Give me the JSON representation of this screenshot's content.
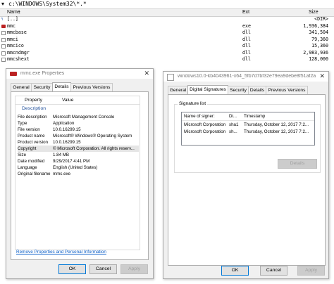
{
  "file_manager": {
    "path": "c:\\WINDOWS\\System32\\*.*",
    "columns": {
      "name": "Name",
      "ext": "Ext",
      "size": "Size",
      "sort_marker": "↓"
    },
    "rows": [
      {
        "name": "[..]",
        "ext": "",
        "size": "<DIR>",
        "icon": "up-folder-icon"
      },
      {
        "name": "mmc",
        "ext": "exe",
        "size": "1,936,384",
        "icon": "mmc-exe-icon"
      },
      {
        "name": "mmcbase",
        "ext": "dll",
        "size": "341,504",
        "icon": "dll-file-icon"
      },
      {
        "name": "mmci",
        "ext": "dll",
        "size": "79,360",
        "icon": "dll-file-icon"
      },
      {
        "name": "mmcico",
        "ext": "dll",
        "size": "15,360",
        "icon": "dll-file-icon"
      },
      {
        "name": "mmcndmgr",
        "ext": "dll",
        "size": "2,983,936",
        "icon": "dll-file-icon"
      },
      {
        "name": "mmcshext",
        "ext": "dll",
        "size": "128,000",
        "icon": "dll-file-icon"
      }
    ]
  },
  "properties_dialog": {
    "title": "mmc.exe Properties",
    "tabs": [
      "General",
      "Security",
      "Details",
      "Previous Versions"
    ],
    "active_tab": "Details",
    "grid_headers": {
      "property": "Property",
      "value": "Value"
    },
    "section": "Description",
    "rows": [
      {
        "k": "File description",
        "v": "Microsoft Management Console"
      },
      {
        "k": "Type",
        "v": "Application"
      },
      {
        "k": "File version",
        "v": "10.0.16299.15"
      },
      {
        "k": "Product name",
        "v": "Microsoft® Windows® Operating System"
      },
      {
        "k": "Product version",
        "v": "10.0.16299.15"
      },
      {
        "k": "Copyright",
        "v": "© Microsoft Corporation. All rights reserv..."
      },
      {
        "k": "Size",
        "v": "1.84 MB"
      },
      {
        "k": "Date modified",
        "v": "9/29/2017 4:41 PM"
      },
      {
        "k": "Language",
        "v": "English (United States)"
      },
      {
        "k": "Original filename",
        "v": "mmc.exe"
      }
    ],
    "link": "Remove Properties and Personal Information",
    "buttons": {
      "ok": "OK",
      "cancel": "Cancel",
      "apply": "Apply"
    }
  },
  "signature_dialog": {
    "title": "windows10.0-kb4043961-x64_5fb7d7bf32e79ea9debe8f51af2a0...",
    "tabs": [
      "General",
      "Digital Signatures",
      "Security",
      "Details",
      "Previous Versions"
    ],
    "active_tab": "Digital Signatures",
    "group_label": "Signature list",
    "list_headers": {
      "signer": "Name of signer:",
      "digest": "Di...",
      "timestamp": "Timestamp"
    },
    "rows": [
      {
        "signer": "Microsoft Corporation",
        "digest": "sha1",
        "timestamp": "Thursday, October 12, 2017 7:2..."
      },
      {
        "signer": "Microsoft Corporation",
        "digest": "sh...",
        "timestamp": "Thursday, October 12, 2017 7:2..."
      }
    ],
    "details_button": "Details",
    "buttons": {
      "ok": "OK",
      "cancel": "Cancel",
      "apply": "Apply"
    }
  }
}
